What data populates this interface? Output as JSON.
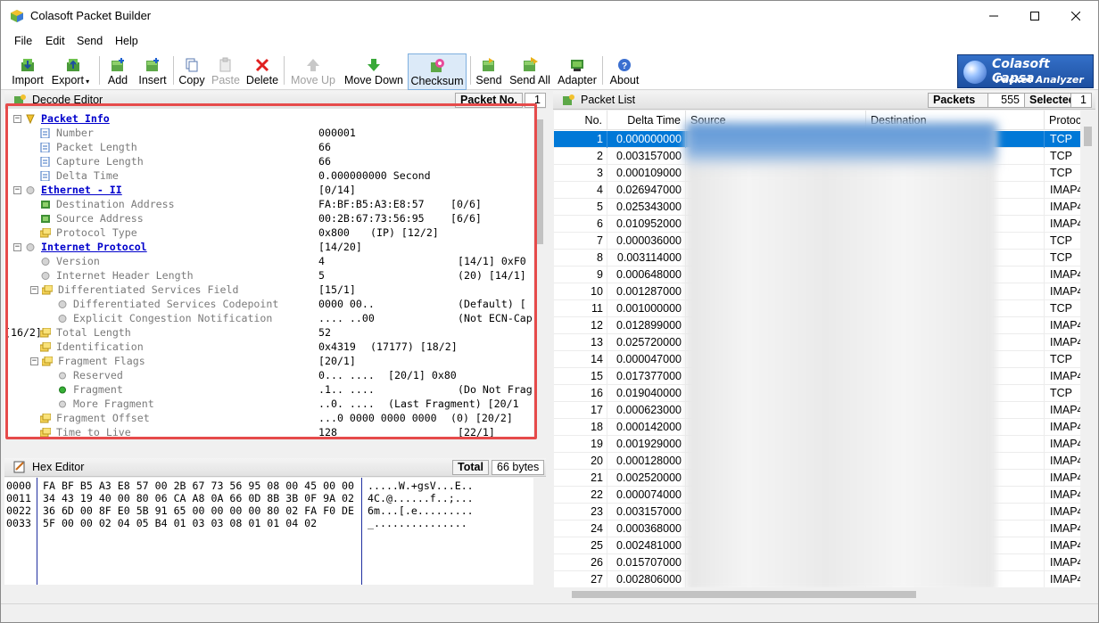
{
  "window": {
    "title": "Colasoft Packet Builder"
  },
  "menu": [
    "File",
    "Edit",
    "Send",
    "Help"
  ],
  "toolbar": {
    "import": "Import",
    "export": "Export",
    "add": "Add",
    "insert": "Insert",
    "copy": "Copy",
    "paste": "Paste",
    "delete": "Delete",
    "move_up": "Move Up",
    "move_down": "Move Down",
    "checksum": "Checksum",
    "send": "Send",
    "send_all": "Send All",
    "adapter": "Adapter",
    "about": "About"
  },
  "logo": {
    "line1": "Colasoft Capsa",
    "line2": "Packet Analyzer"
  },
  "decode_editor": {
    "title": "Decode Editor",
    "packet_no_label": "Packet No.",
    "packet_no": "1",
    "rows": [
      {
        "label": "Packet Info",
        "value": "",
        "extra": ""
      },
      {
        "label": "Number",
        "value": "000001",
        "extra": ""
      },
      {
        "label": "Packet Length",
        "value": "66",
        "extra": ""
      },
      {
        "label": "Capture Length",
        "value": "66",
        "extra": ""
      },
      {
        "label": "Delta Time",
        "value": "0.000000000 Second",
        "extra": ""
      },
      {
        "label": "Ethernet - II",
        "value": "[0/14]",
        "extra": ""
      },
      {
        "label": "Destination Address",
        "value": "FA:BF:B5:A3:E8:57",
        "extra": "[0/6]"
      },
      {
        "label": "Source Address",
        "value": "00:2B:67:73:56:95",
        "extra": "[6/6]"
      },
      {
        "label": "Protocol Type",
        "value": "0x800",
        "extra": "(IP)  [12/2]"
      },
      {
        "label": "Internet Protocol",
        "value": "[14/20]",
        "extra": ""
      },
      {
        "label": "Version",
        "value": "4",
        "extra": "[14/1]  0xF0"
      },
      {
        "label": "Internet Header Length",
        "value": "5",
        "extra": "(20)  [14/1]"
      },
      {
        "label": "Differentiated Services Field",
        "value": "[15/1]",
        "extra": ""
      },
      {
        "label": "Differentiated Services Codepoint",
        "value": "0000 00..",
        "extra": "(Default)  ["
      },
      {
        "label": "Explicit Congestion Notification",
        "value": ".... ..00",
        "extra": "(Not ECN-Cap"
      },
      {
        "label": "Total Length",
        "value": "52",
        "extra": "[16/2]"
      },
      {
        "label": "Identification",
        "value": "0x4319",
        "extra": "(17177)  [18/2]"
      },
      {
        "label": "Fragment Flags",
        "value": "[20/1]",
        "extra": ""
      },
      {
        "label": "Reserved",
        "value": "0... ....",
        "extra": "[20/1]  0x80"
      },
      {
        "label": "Fragment",
        "value": ".1.. ....",
        "extra": "(Do Not Frag"
      },
      {
        "label": "More Fragment",
        "value": "..0. ....",
        "extra": "(Last Fragment)  [20/1"
      },
      {
        "label": "Fragment Offset",
        "value": "...0 0000 0000 0000",
        "extra": "(0)  [20/2]"
      },
      {
        "label": "Time to Live",
        "value": "128",
        "extra": "[22/1]"
      }
    ]
  },
  "hex_editor": {
    "title": "Hex Editor",
    "total_label": "Total",
    "total_value": "66 bytes",
    "lines": [
      {
        "offset": "0000",
        "hex": "FA BF B5 A3 E8 57 00 2B 67 73 56 95 08 00 45 00 00",
        "ascii": ".....W.+gsV...E.."
      },
      {
        "offset": "0011",
        "hex": "34 43 19 40 00 80 06 CA A8 0A 66 0D 8B 3B 0F 9A 02",
        "ascii": "4C.@......f..;..."
      },
      {
        "offset": "0022",
        "hex": "36 6D 00 8F E0 5B 91 65 00 00 00 00 80 02 FA F0 DE",
        "ascii": "6m...[.e........."
      },
      {
        "offset": "0033",
        "hex": "5F 00 00 02 04 05 B4 01 03 03 08 01 01 04 02",
        "ascii": "_..............."
      }
    ]
  },
  "packet_list": {
    "title": "Packet List",
    "packets_label": "Packets",
    "packets_value": "555",
    "selected_label": "Selected",
    "selected_value": "1",
    "columns": [
      "No.",
      "Delta Time",
      "Source",
      "Destination",
      "Protoco"
    ],
    "rows": [
      {
        "no": "1",
        "delta": "0.000000000",
        "proto": "TCP"
      },
      {
        "no": "2",
        "delta": "0.003157000",
        "proto": "TCP"
      },
      {
        "no": "3",
        "delta": "0.000109000",
        "proto": "TCP"
      },
      {
        "no": "4",
        "delta": "0.026947000",
        "proto": "IMAP4"
      },
      {
        "no": "5",
        "delta": "0.025343000",
        "proto": "IMAP4"
      },
      {
        "no": "6",
        "delta": "0.010952000",
        "proto": "IMAP4"
      },
      {
        "no": "7",
        "delta": "0.000036000",
        "proto": "TCP"
      },
      {
        "no": "8",
        "delta": "0.003114000",
        "proto": "TCP"
      },
      {
        "no": "9",
        "delta": "0.000648000",
        "proto": "IMAP4"
      },
      {
        "no": "10",
        "delta": "0.001287000",
        "proto": "IMAP4"
      },
      {
        "no": "11",
        "delta": "0.001000000",
        "proto": "TCP"
      },
      {
        "no": "12",
        "delta": "0.012899000",
        "proto": "IMAP4"
      },
      {
        "no": "13",
        "delta": "0.025720000",
        "proto": "IMAP4"
      },
      {
        "no": "14",
        "delta": "0.000047000",
        "proto": "TCP"
      },
      {
        "no": "15",
        "delta": "0.017377000",
        "proto": "IMAP4"
      },
      {
        "no": "16",
        "delta": "0.019040000",
        "proto": "TCP"
      },
      {
        "no": "17",
        "delta": "0.000623000",
        "proto": "IMAP4"
      },
      {
        "no": "18",
        "delta": "0.000142000",
        "proto": "IMAP4"
      },
      {
        "no": "19",
        "delta": "0.001929000",
        "proto": "IMAP4"
      },
      {
        "no": "20",
        "delta": "0.000128000",
        "proto": "IMAP4"
      },
      {
        "no": "21",
        "delta": "0.002520000",
        "proto": "IMAP4"
      },
      {
        "no": "22",
        "delta": "0.000074000",
        "proto": "IMAP4"
      },
      {
        "no": "23",
        "delta": "0.003157000",
        "proto": "IMAP4"
      },
      {
        "no": "24",
        "delta": "0.000368000",
        "proto": "IMAP4"
      },
      {
        "no": "25",
        "delta": "0.002481000",
        "proto": "IMAP4"
      },
      {
        "no": "26",
        "delta": "0.015707000",
        "proto": "IMAP4"
      },
      {
        "no": "27",
        "delta": "0.002806000",
        "proto": "IMAP4"
      }
    ]
  },
  "colors": {
    "selection": "#0078d7",
    "highlight_border": "#e64b4b",
    "section_link": "#0000cc",
    "offset_green": "#2e9a2e"
  }
}
